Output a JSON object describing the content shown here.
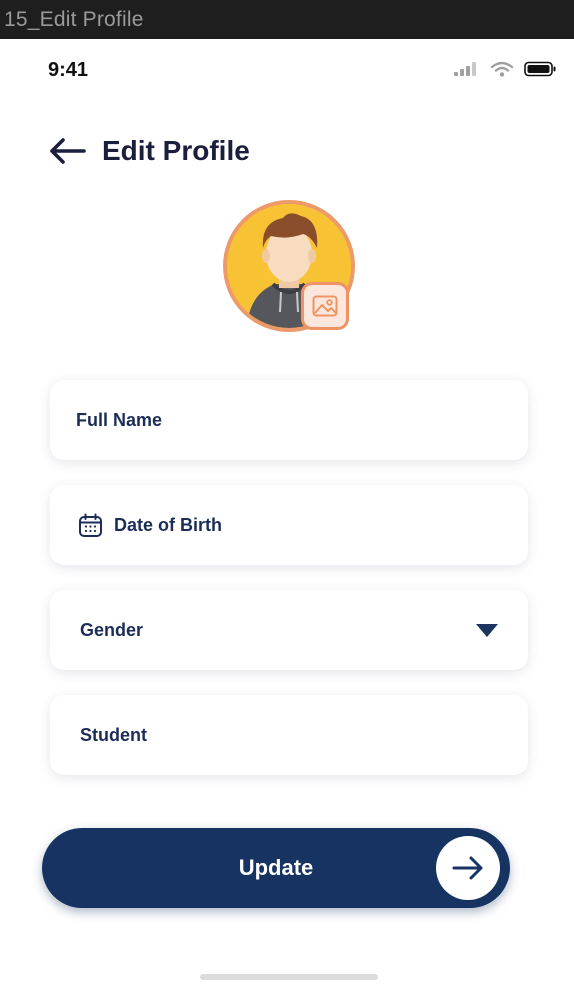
{
  "frame": {
    "title": "15_Edit Profile"
  },
  "status_bar": {
    "time": "9:41",
    "icons": [
      "signal-icon",
      "wifi-icon",
      "battery-icon"
    ]
  },
  "header": {
    "title": "Edit Profile",
    "back_icon": "back-arrow-icon"
  },
  "avatar": {
    "edit_icon": "image-icon"
  },
  "form": {
    "full_name": {
      "label": "Full Name"
    },
    "date_of_birth": {
      "label": "Date of Birth",
      "icon": "calendar-icon"
    },
    "gender": {
      "label": "Gender",
      "icon": "dropdown-caret-icon"
    },
    "role": {
      "label": "Student"
    }
  },
  "update_button": {
    "label": "Update",
    "icon": "arrow-right-icon"
  },
  "colors": {
    "primary": "#163362",
    "text_dark": "#1c2e57",
    "avatar_bg": "#f7c334",
    "accent": "#ee9464"
  }
}
